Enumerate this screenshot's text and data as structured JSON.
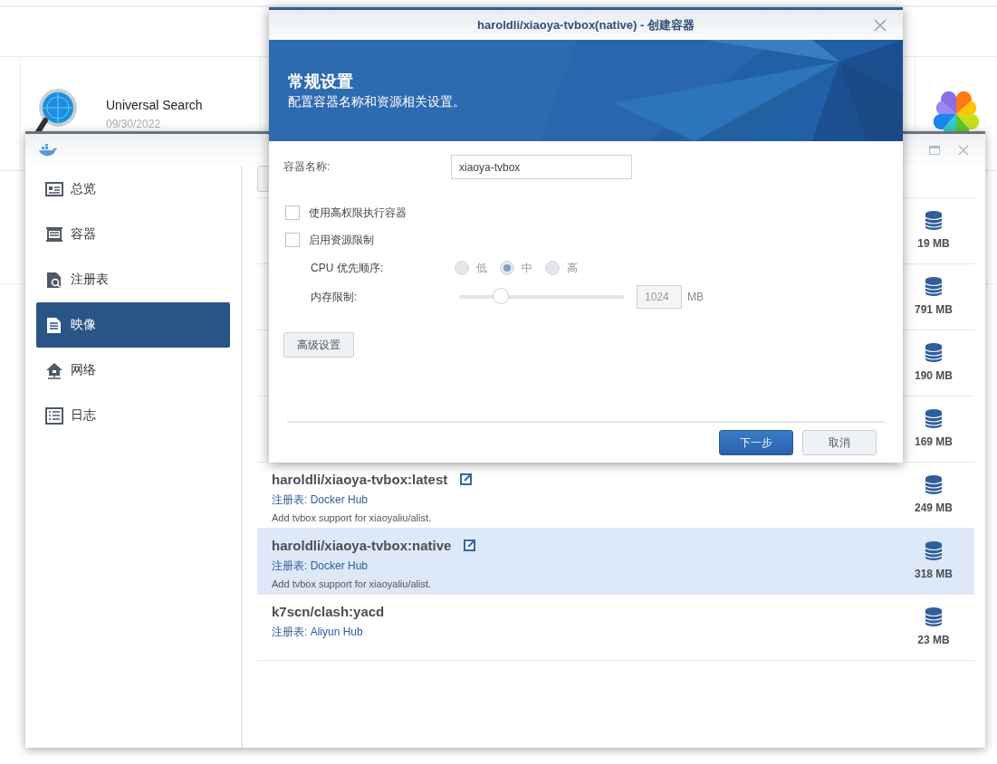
{
  "background": {
    "apps": [
      {
        "name": "Universal Search",
        "date": "09/30/2022"
      }
    ]
  },
  "docker_window": {
    "sidebar": [
      {
        "label": "总览",
        "selected": false
      },
      {
        "label": "容器",
        "selected": false
      },
      {
        "label": "注册表",
        "selected": false
      },
      {
        "label": "映像",
        "selected": true
      },
      {
        "label": "网络",
        "selected": false
      },
      {
        "label": "日志",
        "selected": false
      }
    ],
    "images": [
      {
        "size": "19 MB",
        "selected": false
      },
      {
        "size": "791 MB",
        "selected": false
      },
      {
        "size": "190 MB",
        "selected": false
      },
      {
        "size": "169 MB",
        "selected": false
      },
      {
        "name": "haroldli/xiaoya-tvbox:latest",
        "link": true,
        "registry": "注册表: Docker Hub",
        "description": "Add tvbox support for xiaoyaliu/alist.",
        "size": "249 MB",
        "selected": false
      },
      {
        "name": "haroldli/xiaoya-tvbox:native",
        "link": true,
        "registry": "注册表: Docker Hub",
        "description": "Add tvbox support for xiaoyaliu/alist.",
        "size": "318 MB",
        "selected": true
      },
      {
        "name": "k7scn/clash:yacd",
        "link": false,
        "registry": "注册表: Aliyun Hub",
        "size": "23 MB",
        "selected": false
      }
    ]
  },
  "dialog": {
    "title": "haroldli/xiaoya-tvbox(native) - 创建容器",
    "heading": "常规设置",
    "subheading": "配置容器名称和资源相关设置。",
    "name_field": {
      "label": "容器名称:",
      "value": "xiaoya-tvbox"
    },
    "checkboxes": [
      {
        "label": "使用高权限执行容器",
        "checked": false
      },
      {
        "label": "启用资源限制",
        "checked": false
      }
    ],
    "cpu_priority": {
      "label": "CPU 优先顺序:",
      "disabled": true,
      "options": [
        {
          "label": "低",
          "selected": false
        },
        {
          "label": "中",
          "selected": true
        },
        {
          "label": "高",
          "selected": false
        }
      ]
    },
    "memory_limit": {
      "label": "内存限制:",
      "disabled": true,
      "level": 0.25,
      "value": "1024",
      "unit": "MB"
    },
    "advanced_button": "高级设置",
    "buttons": [
      {
        "label": "下一步",
        "kind": "primary"
      },
      {
        "label": "取消",
        "kind": "secondary"
      }
    ]
  }
}
